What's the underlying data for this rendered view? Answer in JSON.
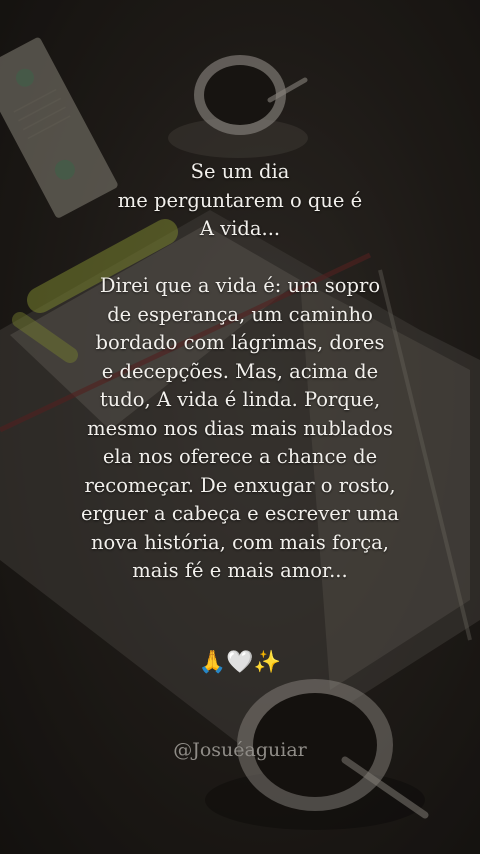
{
  "quote": {
    "intro_lines": [
      "Se um dia",
      "me perguntarem o que é",
      "A vida..."
    ],
    "body_lines": [
      "Direi que a vida é: um sopro",
      "de esperança, um caminho",
      "bordado com lágrimas, dores",
      "e decepções. Mas, acima de",
      "tudo, A vida é linda. Porque,",
      "mesmo nos dias mais nublados",
      "ela nos oferece a chance de",
      "recomeçar. De enxugar o rosto,",
      "erguer a cabeça e escrever uma",
      "nova história, com mais força,",
      "mais fé e mais amor..."
    ]
  },
  "emoji": "🙏🤍✨",
  "handle": "@Josuéaguiar",
  "background": {
    "scene_icons": [
      "bookmark-icon",
      "coffee-cup-icon",
      "open-book-icon",
      "coffee-cup-icon"
    ]
  },
  "colors": {
    "text": "#f2f0ec",
    "handle": "#8f8c87",
    "background": "#24201c"
  }
}
